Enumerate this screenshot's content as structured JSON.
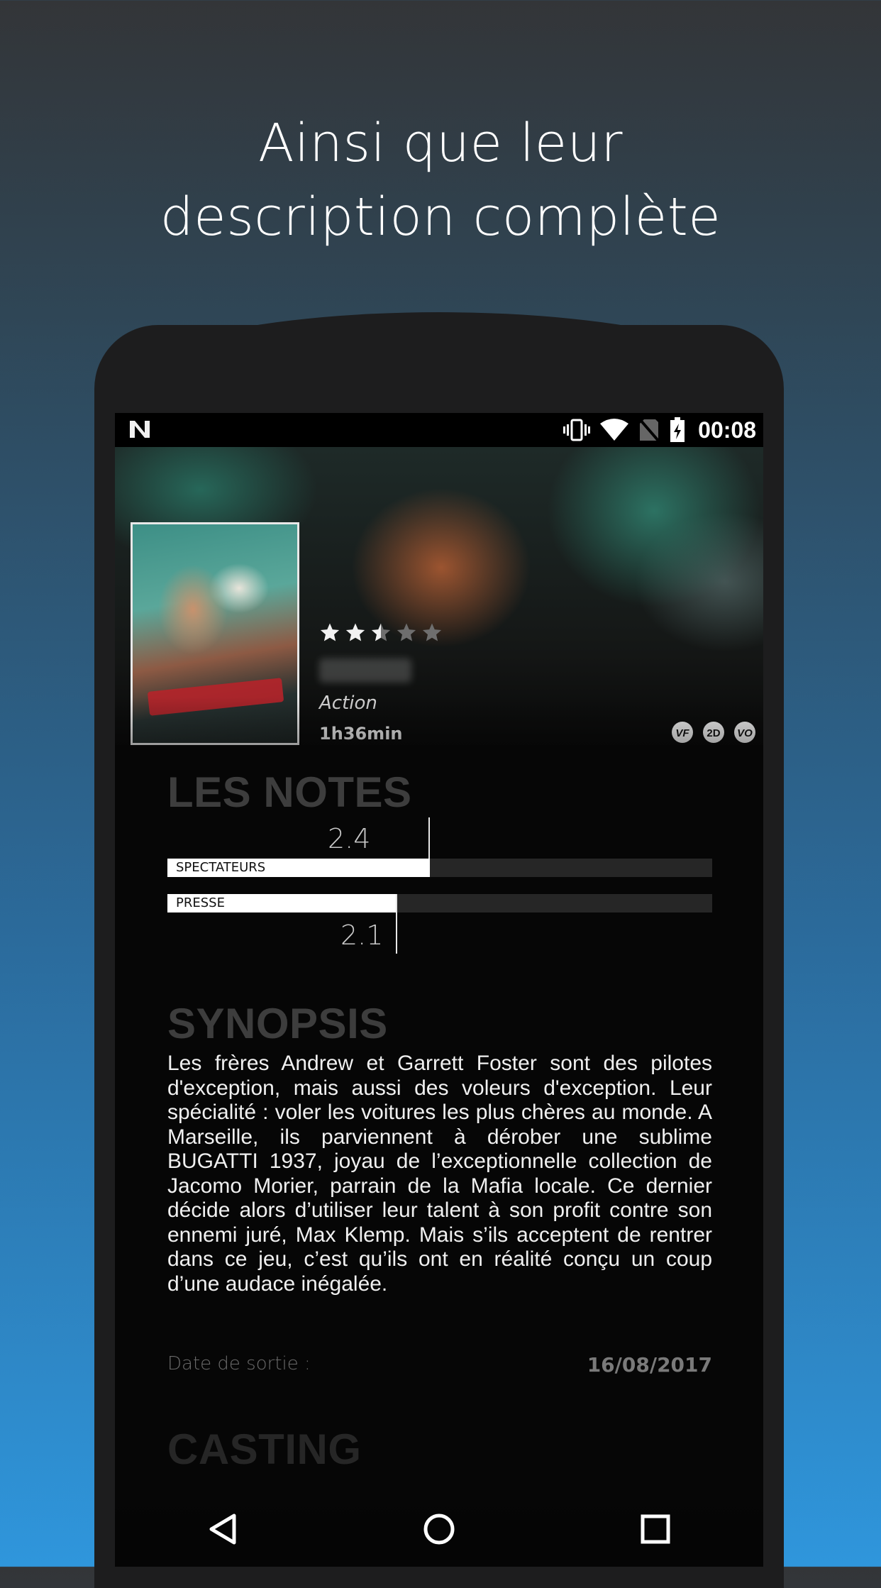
{
  "headline": {
    "line1": "Ainsi que leur",
    "line2": "description complète"
  },
  "status_bar": {
    "time": "00:08",
    "icons": [
      "n-logo-icon",
      "vibrate-icon",
      "wifi-icon",
      "no-sim-icon",
      "battery-icon"
    ]
  },
  "movie": {
    "rating_stars": 2.5,
    "rating_max": 5,
    "genre": "Action",
    "duration": "1h36min",
    "badges": [
      "VF",
      "2D",
      "VO"
    ]
  },
  "notes": {
    "title": "LES NOTES",
    "spectators": {
      "label": "SPECTATEURS",
      "value": "2.4"
    },
    "press": {
      "label": "PRESSE",
      "value": "2.1"
    }
  },
  "synopsis": {
    "title": "SYNOPSIS",
    "text": "Les frères Andrew et Garrett Foster sont des pilotes d'exception, mais aussi des voleurs d'exception. Leur spécialité : voler les voitures les plus chères au monde. A Marseille, ils parviennent à dérober une sublime BUGATTI 1937, joyau de l’exceptionnelle collection de Jacomo Morier, parrain de la Mafia locale.  Ce dernier décide alors d’utiliser leur talent à son profit contre son ennemi juré, Max Klemp. Mais s’ils acceptent de rentrer dans ce jeu, c’est qu’ils ont en réalité conçu un coup d’une audace inégalée."
  },
  "release": {
    "label": "Date de sortie :",
    "date": "16/08/2017"
  },
  "casting": {
    "title": "CASTING"
  },
  "navbar": {
    "buttons": [
      "back-icon",
      "home-icon",
      "recents-icon"
    ]
  }
}
